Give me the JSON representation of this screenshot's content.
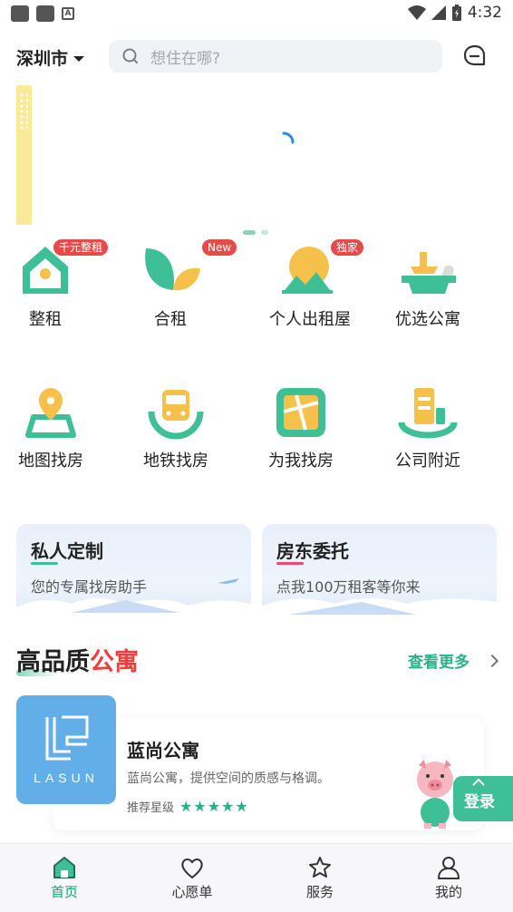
{
  "status_bar": {
    "time": "4:32"
  },
  "header": {
    "city": "深圳市",
    "search_placeholder": "想住在哪?"
  },
  "categories_row1": [
    {
      "label": "整租",
      "badge": "千元整租",
      "icon": "house-icon"
    },
    {
      "label": "合租",
      "badge": "New",
      "icon": "leaves-icon"
    },
    {
      "label": "个人出租屋",
      "badge": "独家",
      "icon": "sun-mountain-icon"
    },
    {
      "label": "优选公寓",
      "badge": "",
      "icon": "bowl-icon"
    }
  ],
  "categories_row2": [
    {
      "label": "地图找房",
      "icon": "map-pin-icon"
    },
    {
      "label": "地铁找房",
      "icon": "metro-icon"
    },
    {
      "label": "为我找房",
      "icon": "map-icon"
    },
    {
      "label": "公司附近",
      "icon": "building-icon"
    }
  ],
  "cards": [
    {
      "title": "私人定制",
      "subtitle": "您的专属找房助手",
      "accent": "#3fbf95"
    },
    {
      "title": "房东委托",
      "subtitle": "点我100万租客等你来",
      "accent": "#ef4b6a"
    }
  ],
  "section": {
    "title_a": "高品质",
    "title_b": "公寓",
    "more": "查看更多"
  },
  "apartment": {
    "logo_text": "LASUN",
    "name": "蓝尚公寓",
    "description": "蓝尚公寓，提供空间的质感与格调。",
    "rating_label": "推荐星级",
    "stars": "★★★★★",
    "rating": 5
  },
  "floating": {
    "login": "登录"
  },
  "tabs": [
    {
      "label": "首页",
      "icon": "home-icon",
      "active": true
    },
    {
      "label": "心愿单",
      "icon": "heart-icon",
      "active": false
    },
    {
      "label": "服务",
      "icon": "star-icon",
      "active": false
    },
    {
      "label": "我的",
      "icon": "user-icon",
      "active": false
    }
  ],
  "colors": {
    "brand_green": "#3fbf95",
    "accent_red": "#ef3e3e",
    "badge_red": "#e84a4a",
    "logo_blue": "#61aee8"
  }
}
